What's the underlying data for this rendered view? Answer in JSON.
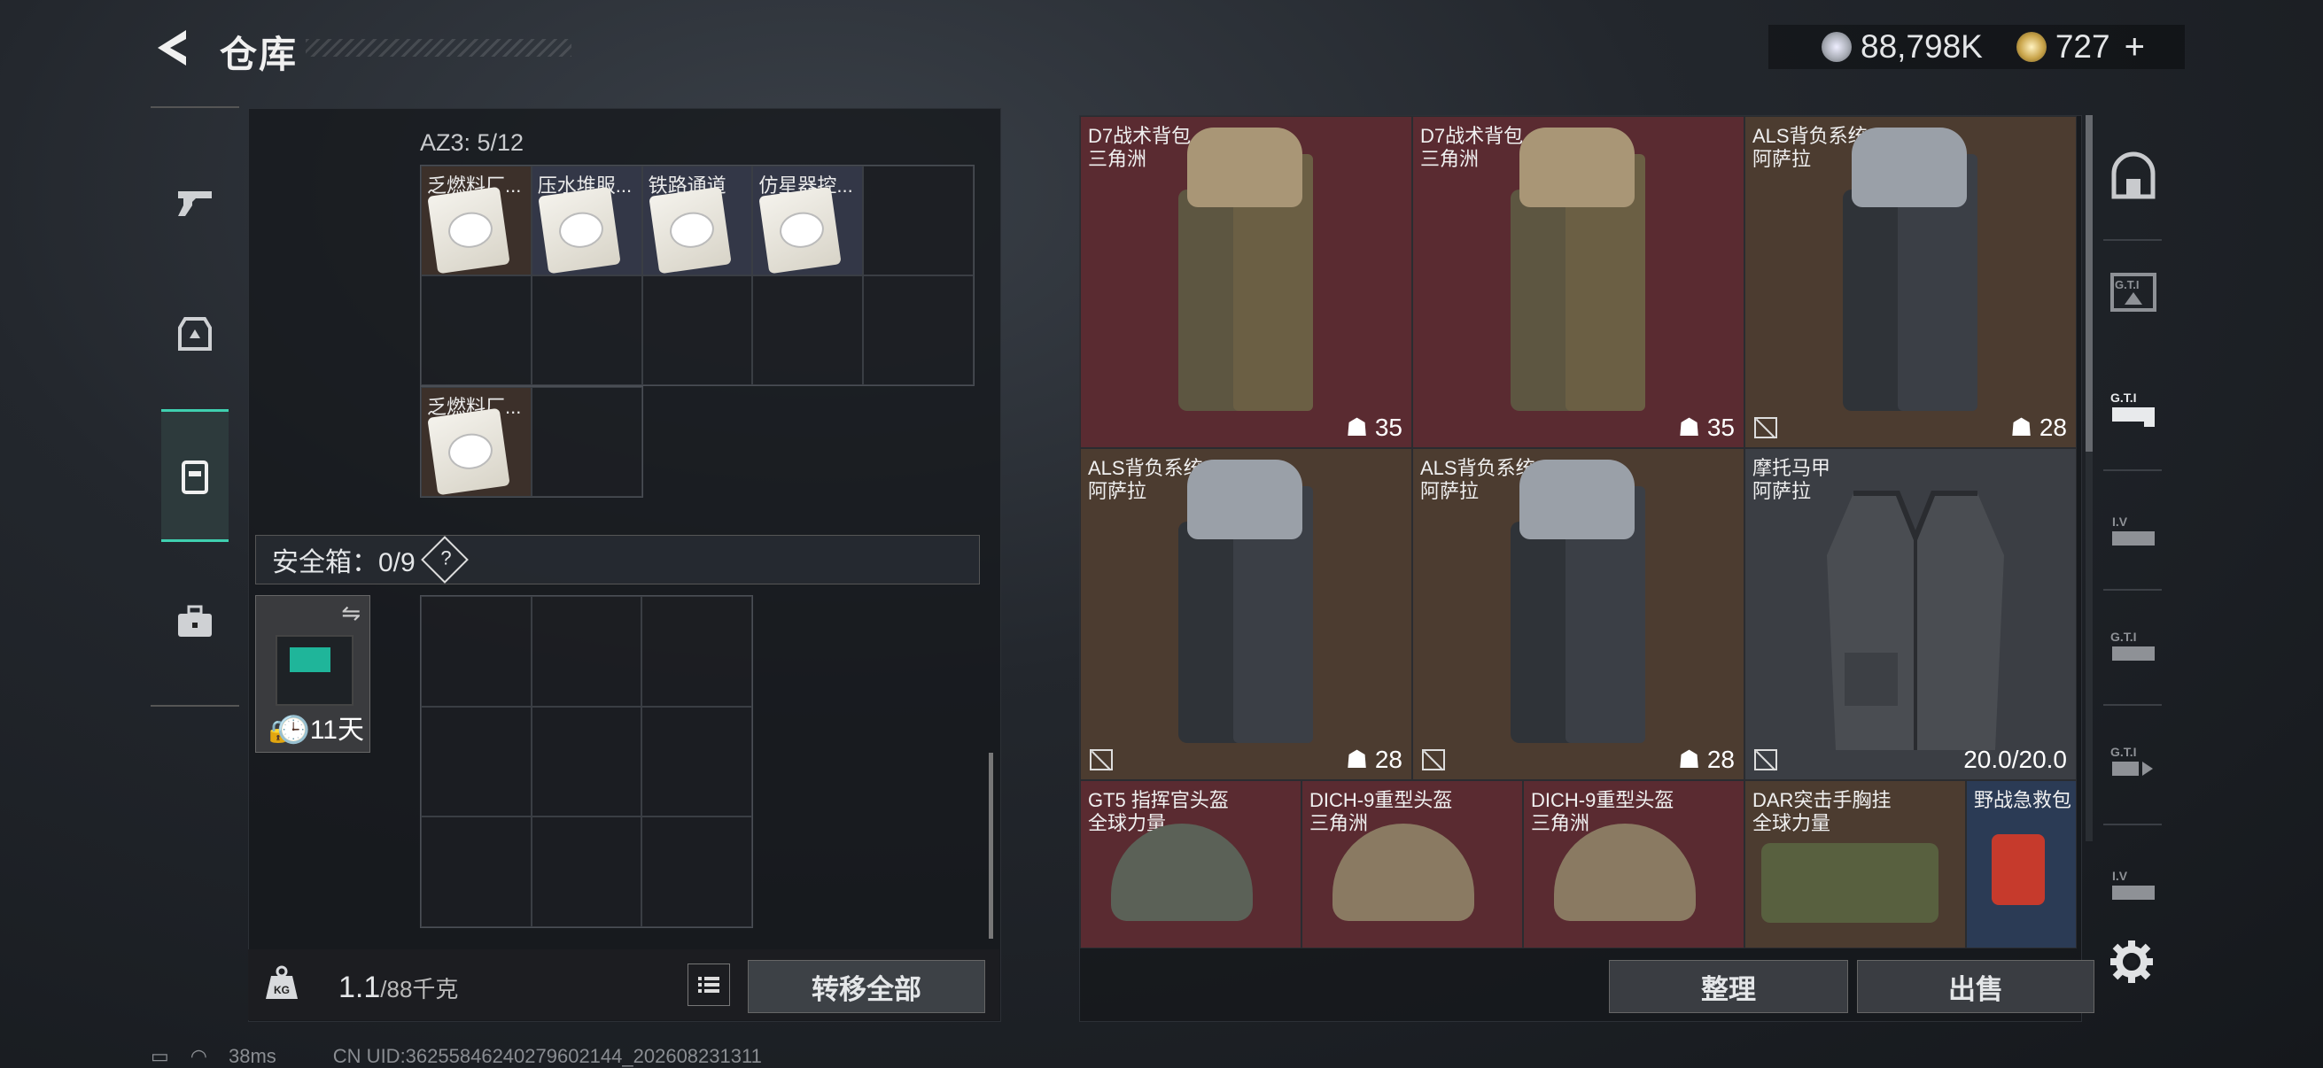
{
  "header": {
    "title": "仓库",
    "silver_amount": "88,798K",
    "gold_amount": "727",
    "gold_plus": "+"
  },
  "left_panel": {
    "section_label": "AZ3: 5/12",
    "items": [
      {
        "name": "乏燃料厂..."
      },
      {
        "name": "压水堆服..."
      },
      {
        "name": "铁路通道"
      },
      {
        "name": "仿星器控..."
      },
      {
        "name": "乏燃料厂..."
      }
    ],
    "safe_label": "安全箱：0/9",
    "safe_help": "?",
    "safebox_days": "11天",
    "weight_value": "1.1",
    "weight_max": "/88千克",
    "transfer_all": "转移全部"
  },
  "right_panel": {
    "items": [
      {
        "name": "D7战术背包",
        "origin": "三角洲",
        "capacity": "35"
      },
      {
        "name": "D7战术背包",
        "origin": "三角洲",
        "capacity": "35"
      },
      {
        "name": "ALS背负系统",
        "origin": "阿萨拉",
        "capacity": "28"
      },
      {
        "name": "ALS背负系统",
        "origin": "阿萨拉",
        "capacity": "28"
      },
      {
        "name": "ALS背负系统",
        "origin": "阿萨拉",
        "capacity": "28"
      },
      {
        "name": "摩托马甲",
        "origin": "阿萨拉",
        "capacity": "20.0/20.0"
      },
      {
        "name": "GT5 指挥官头盔",
        "origin": "全球力量"
      },
      {
        "name": "DICH-9重型头盔",
        "origin": "三角洲"
      },
      {
        "name": "DICH-9重型头盔",
        "origin": "三角洲"
      },
      {
        "name": "DAR突击手胸挂",
        "origin": "全球力量"
      },
      {
        "name": "野战急救包",
        "origin": ""
      }
    ],
    "sort_label": "整理",
    "sell_label": "出售"
  },
  "status_bar": {
    "ping": "38ms",
    "uid": "CN UID:3625584624027960214‍4_202608231311"
  },
  "colors": {
    "accent": "#3fd0b0",
    "item_red": "#5a2b31",
    "item_brown": "#4c3c30",
    "item_blue": "#2b3b55"
  }
}
